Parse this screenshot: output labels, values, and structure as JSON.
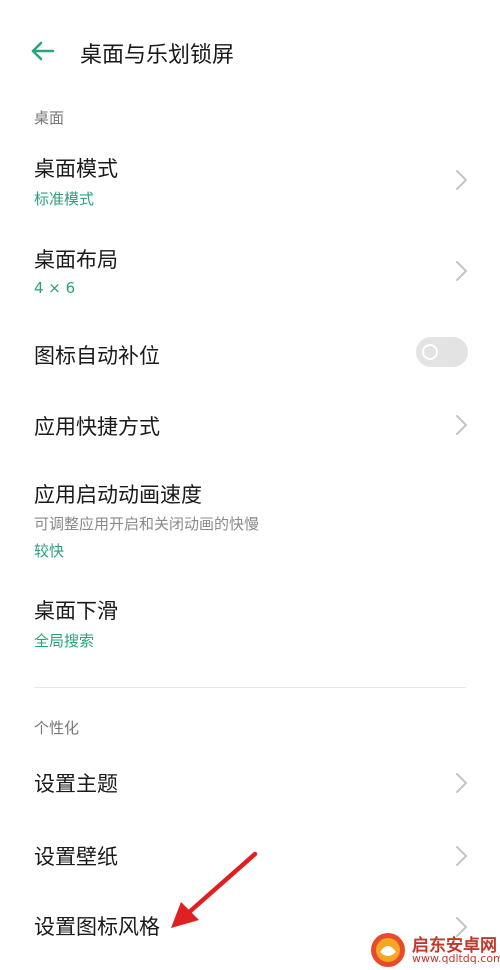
{
  "header": {
    "title": "桌面与乐划锁屏",
    "back_icon": "arrow-left-icon"
  },
  "sections": {
    "desktop": "桌面",
    "personalize": "个性化"
  },
  "rows": {
    "desktop_mode": {
      "title": "桌面模式",
      "value": "标准模式"
    },
    "desktop_layout": {
      "title": "桌面布局",
      "value": "4 × 6"
    },
    "auto_fill_icons": {
      "title": "图标自动补位",
      "toggle": "off"
    },
    "app_shortcuts": {
      "title": "应用快捷方式"
    },
    "app_anim_speed": {
      "title": "应用启动动画速度",
      "description": "可调整应用开启和关闭动画的快慢",
      "value": "较快"
    },
    "desktop_swipe_down": {
      "title": "桌面下滑",
      "value": "全局搜索"
    },
    "set_theme": {
      "title": "设置主题"
    },
    "set_wallpaper": {
      "title": "设置壁纸"
    },
    "set_icon_style": {
      "title": "设置图标风格"
    }
  },
  "watermark": {
    "name": "启东安卓网",
    "url": "www.qdltdq.com"
  },
  "colors": {
    "accent": "#2aa37a",
    "annotation_arrow": "#e02020",
    "watermark": "#c0392b"
  }
}
